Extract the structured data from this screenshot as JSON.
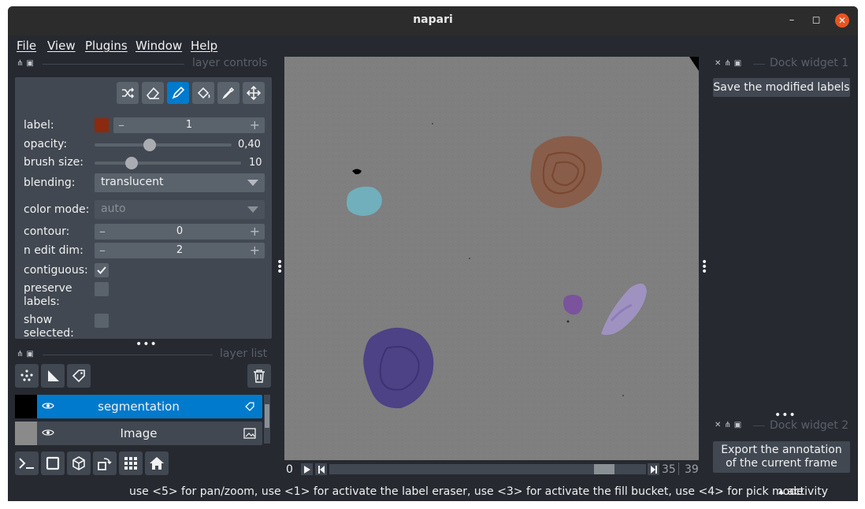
{
  "window": {
    "title": "napari"
  },
  "menu": [
    "File",
    "View",
    "Plugins",
    "Window",
    "Help"
  ],
  "layer_controls": {
    "title": "layer controls",
    "label_label": "label:",
    "label_value": "1",
    "label_color": "#8b2a0e",
    "opacity_label": "opacity:",
    "opacity_value": "0,40",
    "opacity_level": 0.4,
    "brush_size_label": "brush size:",
    "brush_size_value": "10",
    "blending_label": "blending:",
    "blending_value": "translucent",
    "color_mode_label": "color mode:",
    "color_mode_value": "auto",
    "contour_label": "contour:",
    "contour_value": "0",
    "n_edit_dim_label": "n edit dim:",
    "n_edit_dim_value": "2",
    "contiguous_label": "contiguous:",
    "contiguous_checked": true,
    "preserve_labels_label_1": "preserve",
    "preserve_labels_label_2": "labels:",
    "show_selected_label_1": "show",
    "show_selected_label_2": "selected:"
  },
  "layer_list": {
    "title": "layer list",
    "layers": [
      {
        "name": "segmentation",
        "selected": true,
        "type_icon": "label-tag-icon"
      },
      {
        "name": "Image",
        "selected": false,
        "type_icon": "image-icon"
      }
    ]
  },
  "dock1": {
    "title": "Dock widget 1",
    "button": "Save the modified labels"
  },
  "dock2": {
    "title": "Dock widget 2",
    "button_line1": "Export the annotation",
    "button_line2": "of the current frame"
  },
  "dims": {
    "slider_value": "0",
    "current": "35",
    "total": "39",
    "position_fraction": 0.897
  },
  "status": {
    "message": "use <5> for pan/zoom, use <1> for activate the label eraser, use <3> for activate the fill bucket, use <4> for pick mode",
    "activity": "activity"
  },
  "colors": {
    "accent": "#007acc",
    "background": "#262930",
    "panel": "#414851"
  }
}
